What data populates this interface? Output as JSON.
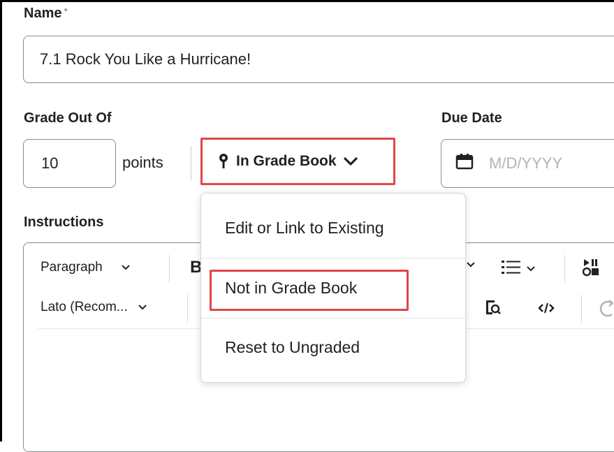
{
  "form": {
    "name_label": "Name",
    "required_marker": "*",
    "name_value": "7.1 Rock You Like a Hurricane!",
    "grade_label": "Grade Out Of",
    "points_value": "10",
    "points_unit": "points",
    "gradebook_button": "In Grade Book",
    "due_label": "Due Date",
    "due_placeholder": "M/D/YYYY",
    "instructions_label": "Instructions"
  },
  "editor_toolbar": {
    "paragraph": "Paragraph",
    "font": "Lato (Recom...",
    "bold_fragment": "B"
  },
  "gradebook_menu": {
    "items": [
      "Edit or Link to Existing",
      "Not in Grade Book",
      "Reset to Ungraded"
    ]
  },
  "colors": {
    "highlight": "#e0454a",
    "border": "#868c8f",
    "placeholder": "#b0b4b7"
  },
  "icons": [
    "pin-icon",
    "chevron-down-icon",
    "calendar-icon",
    "list-icon",
    "media-icon",
    "find-replace-icon",
    "code-icon",
    "undo-icon"
  ]
}
